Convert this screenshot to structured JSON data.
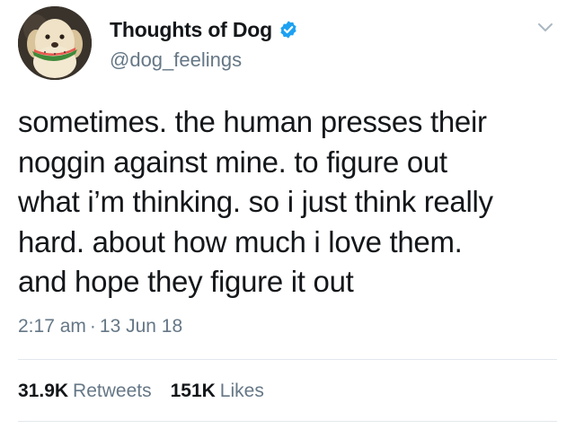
{
  "user": {
    "display_name": "Thoughts of Dog",
    "handle": "@dog_feelings",
    "verified": true,
    "avatar_icon": "dog-with-watermelon-avatar"
  },
  "tweet": {
    "text": "sometimes. the human presses their\nnoggin against mine. to figure out\nwhat i’m thinking. so i just think really\nhard. about how much i love them.\nand hope they figure it out",
    "time": "2:17 am",
    "separator": "·",
    "date": "13 Jun 18"
  },
  "stats": {
    "retweets_count": "31.9K",
    "retweets_label": "Retweets",
    "likes_count": "151K",
    "likes_label": "Likes"
  },
  "colors": {
    "text_primary": "#14171a",
    "text_secondary": "#657786",
    "verified_blue": "#1da1f2",
    "divider": "#e1e8ed"
  },
  "icons": {
    "verified": "verified-badge-icon",
    "menu": "chevron-down-icon"
  }
}
